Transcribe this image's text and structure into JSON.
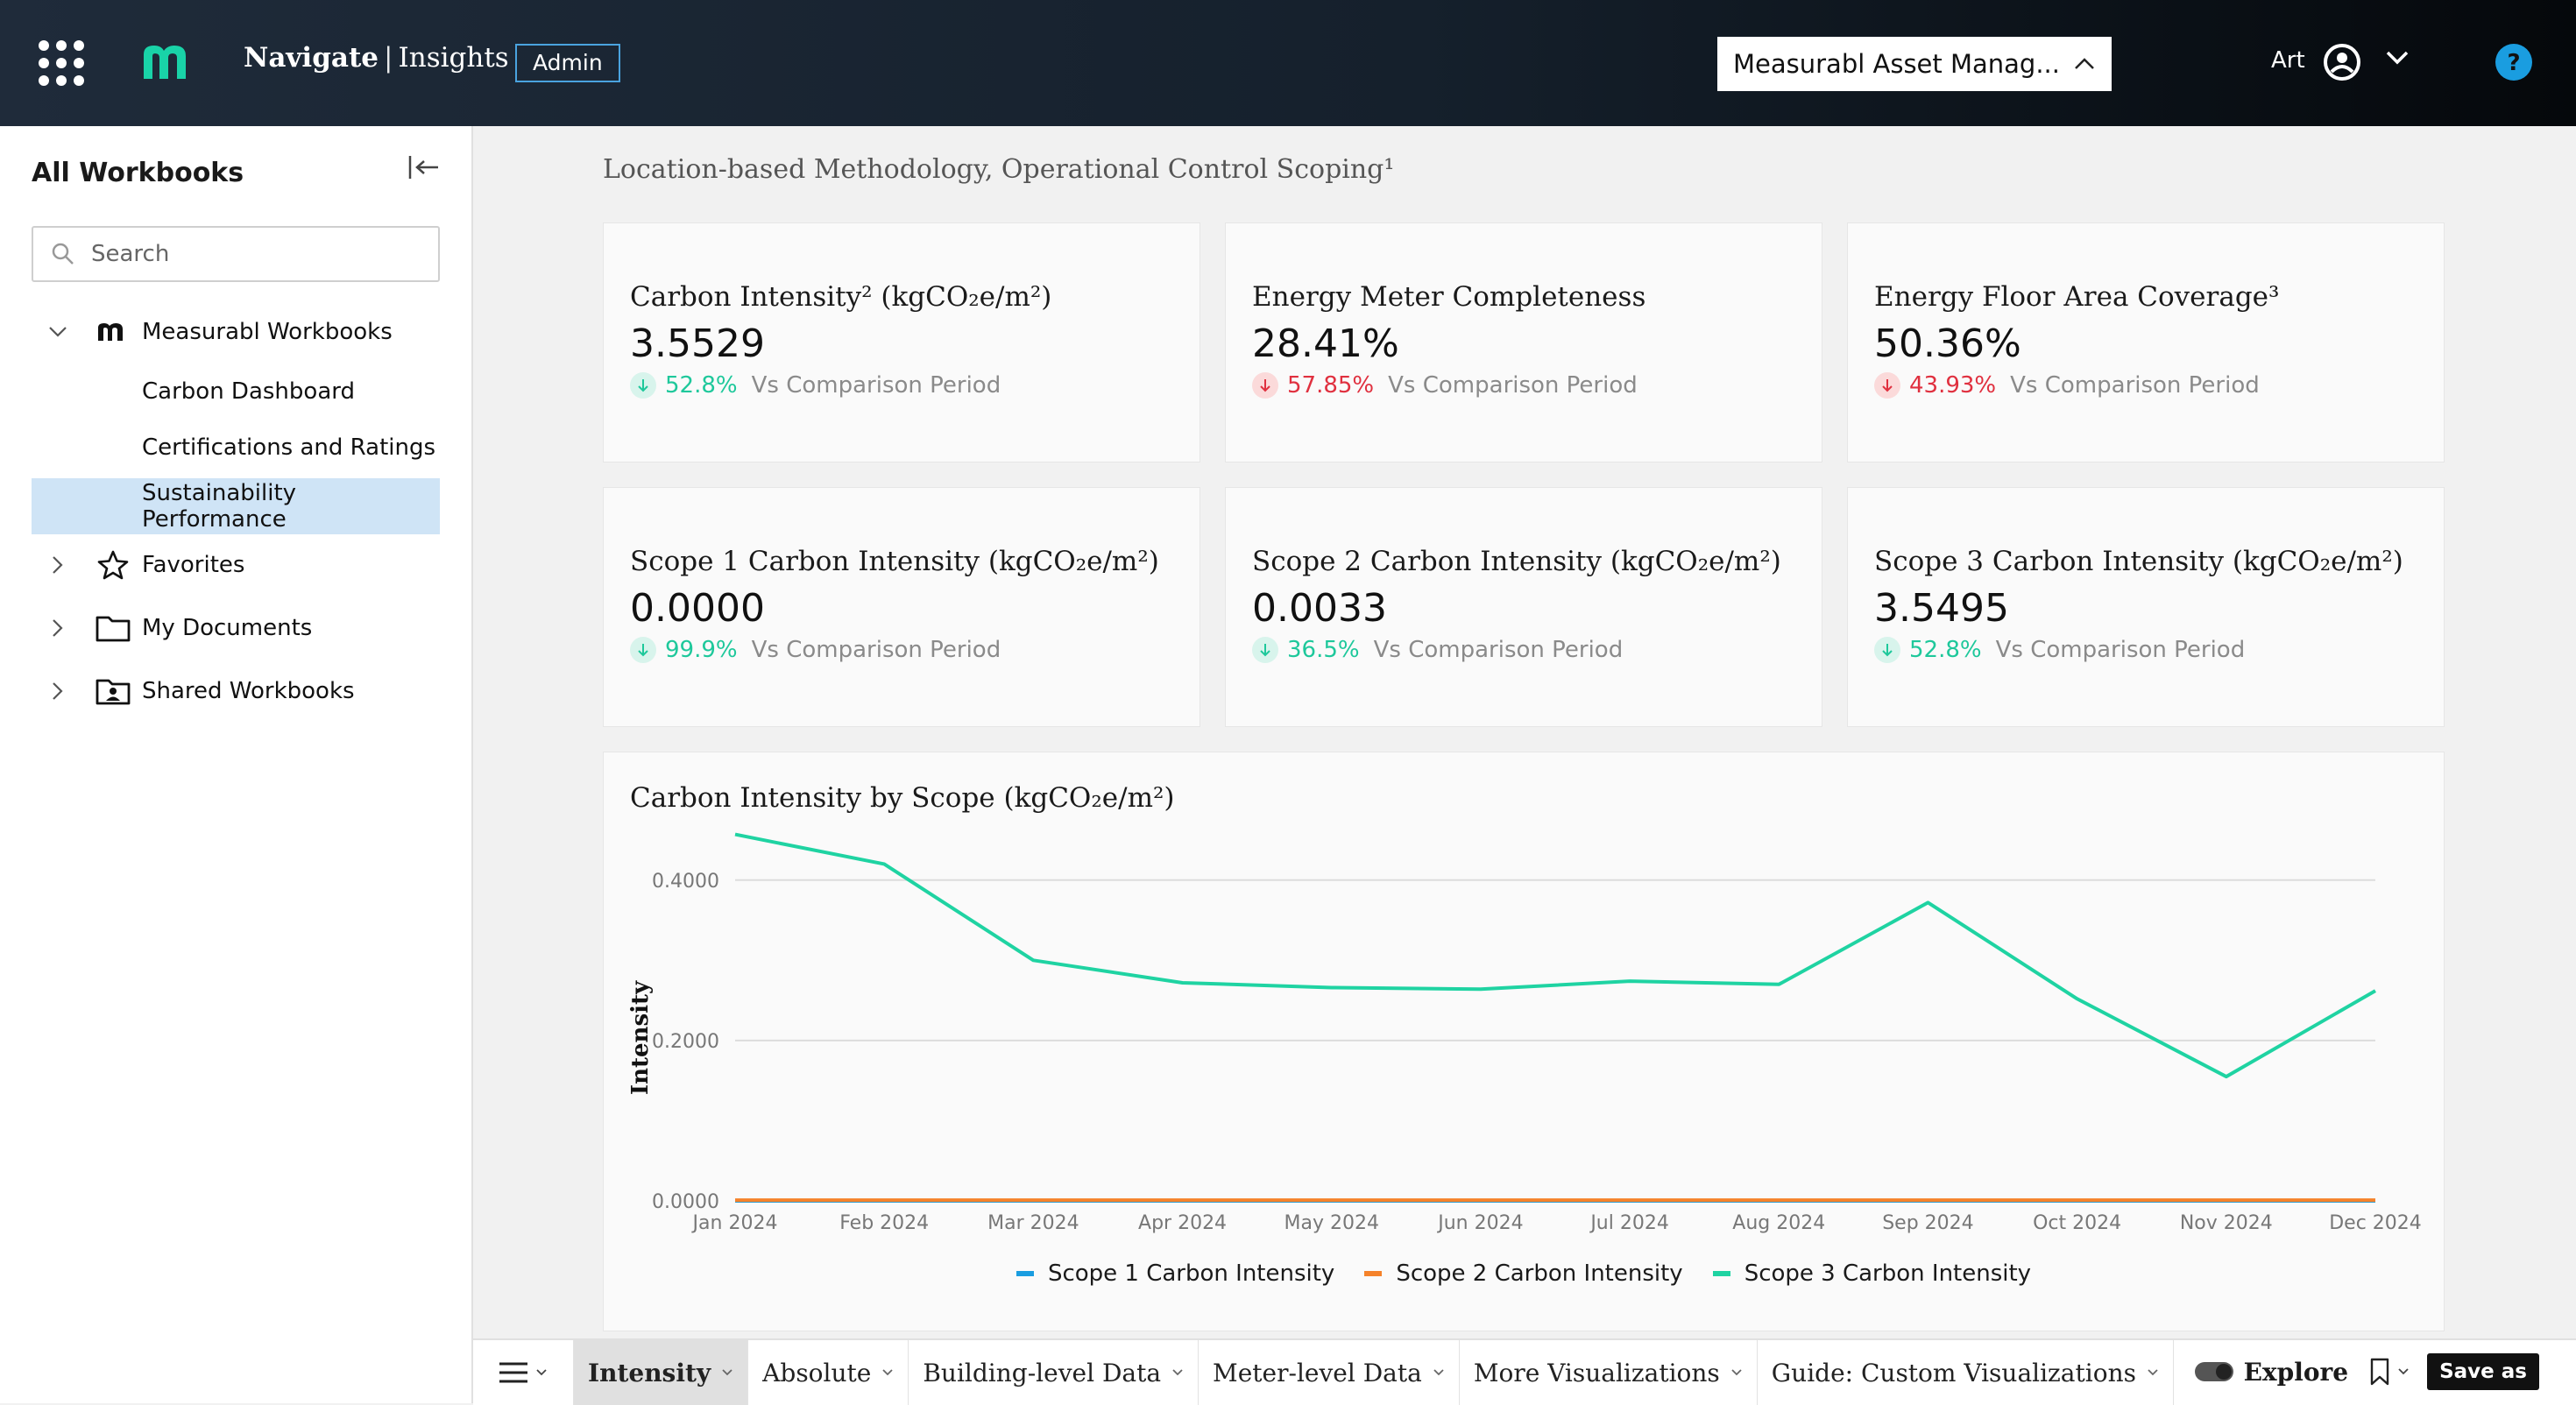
{
  "header": {
    "brand_bold": "Navigate",
    "brand_separator": "|",
    "brand_light": "Insights",
    "admin_badge": "Admin",
    "org_selector": "Measurabl Asset Manag...",
    "user_name": "Art"
  },
  "sidebar": {
    "title": "All Workbooks",
    "search_placeholder": "Search",
    "items": [
      {
        "label": "Measurabl Workbooks",
        "icon": "measurabl-logo-icon",
        "expanded": true
      },
      {
        "label": "Carbon Dashboard"
      },
      {
        "label": "Certifications and Ratings"
      },
      {
        "label": "Sustainability Performance",
        "active": true
      },
      {
        "label": "Favorites",
        "icon": "star-icon"
      },
      {
        "label": "My Documents",
        "icon": "folder-icon"
      },
      {
        "label": "Shared Workbooks",
        "icon": "shared-folder-icon"
      }
    ]
  },
  "main": {
    "subtitle": "Location-based Methodology, Operational Control Scoping¹",
    "comparison_text": "Vs Comparison Period",
    "kpis": [
      {
        "title": "Carbon Intensity² (kgCO₂e/m²)",
        "value": "3.5529",
        "delta": "52.8%",
        "trend": "down",
        "status": "good"
      },
      {
        "title": "Energy Meter Completeness",
        "value": "28.41%",
        "delta": "57.85%",
        "trend": "down",
        "status": "bad"
      },
      {
        "title": "Energy Floor Area Coverage³",
        "value": "50.36%",
        "delta": "43.93%",
        "trend": "down",
        "status": "bad"
      },
      {
        "title": "Scope 1 Carbon Intensity (kgCO₂e/m²)",
        "value": "0.0000",
        "delta": "99.9%",
        "trend": "down",
        "status": "good"
      },
      {
        "title": "Scope 2 Carbon Intensity (kgCO₂e/m²)",
        "value": "0.0033",
        "delta": "36.5%",
        "trend": "down",
        "status": "good"
      },
      {
        "title": "Scope 3 Carbon Intensity (kgCO₂e/m²)",
        "value": "3.5495",
        "delta": "52.8%",
        "trend": "down",
        "status": "good"
      }
    ]
  },
  "chart_data": {
    "type": "line",
    "title": "Carbon Intensity by Scope (kgCO₂e/m²)",
    "xlabel": "",
    "ylabel": "Intensity",
    "categories": [
      "Jan 2024",
      "Feb 2024",
      "Mar 2024",
      "Apr 2024",
      "May 2024",
      "Jun 2024",
      "Jul 2024",
      "Aug 2024",
      "Sep 2024",
      "Oct 2024",
      "Nov 2024",
      "Dec 2024"
    ],
    "ylim": [
      0,
      0.45
    ],
    "yticks": [
      "0.0000",
      "0.2000",
      "0.4000"
    ],
    "ytick_values": [
      0,
      0.2,
      0.4
    ],
    "grid": true,
    "legend": "bottom",
    "series": [
      {
        "name": "Scope 1 Carbon Intensity",
        "color": "#1a9de0",
        "values": [
          0,
          0,
          0,
          0,
          0,
          0,
          0,
          0,
          0,
          0,
          0,
          0
        ]
      },
      {
        "name": "Scope 2 Carbon Intensity",
        "color": "#f5822a",
        "values": [
          0.001,
          0.001,
          0.001,
          0.001,
          0.001,
          0.001,
          0.001,
          0.001,
          0.001,
          0.001,
          0.001,
          0.001
        ]
      },
      {
        "name": "Scope 3 Carbon Intensity",
        "color": "#1fd3a2",
        "values": [
          0.457,
          0.42,
          0.3,
          0.272,
          0.266,
          0.264,
          0.274,
          0.27,
          0.372,
          0.252,
          0.155,
          0.262
        ]
      }
    ]
  },
  "bottom_bar": {
    "tabs": [
      "Intensity",
      "Absolute",
      "Building-level Data",
      "Meter-level Data",
      "More Visualizations",
      "Guide: Custom Visualizations"
    ],
    "active_tab": "Intensity",
    "explore_label": "Explore",
    "save_label": "Save as"
  },
  "colors": {
    "good": "#1ec89b",
    "bad": "#e0303f",
    "accent": "#1a9de0",
    "active_nav": "#cfe4f6"
  }
}
